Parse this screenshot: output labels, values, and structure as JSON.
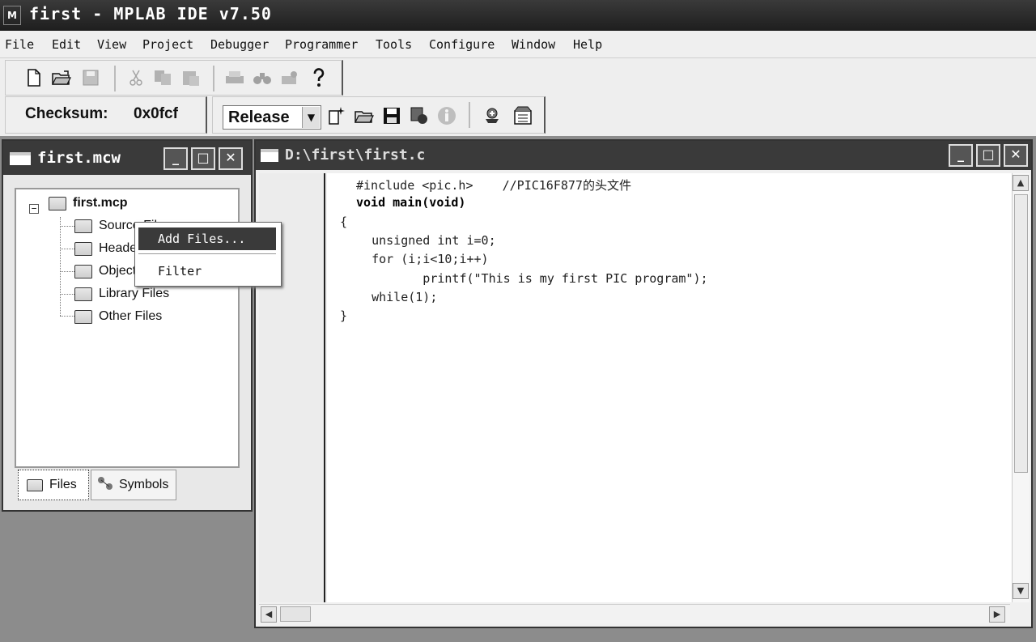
{
  "window": {
    "app_title": "first - MPLAB IDE v7.50",
    "logo_icon": "mplab-logo-icon"
  },
  "menu": [
    "File",
    "Edit",
    "View",
    "Project",
    "Debugger",
    "Programmer",
    "Tools",
    "Configure",
    "Window",
    "Help"
  ],
  "toolbar": {
    "checksum_label": "Checksum:",
    "checksum_value": "0x0fcf",
    "build_config": "Release"
  },
  "project_window": {
    "title": "first.mcw",
    "root": "first.mcp",
    "folders": [
      "Source Files",
      "Header Files",
      "Object Files",
      "Library Files",
      "Other Files"
    ],
    "tabs": [
      "Files",
      "Symbols"
    ]
  },
  "context_menu": {
    "items": [
      "Add Files...",
      "Filter"
    ]
  },
  "editor": {
    "title": "D:\\first\\first.c",
    "lines": [
      "#include <pic.h>    //PIC16F877的头文件",
      "void main(void)",
      "{",
      "   unsigned int i=0;",
      "   for (i;i<10;i++)",
      "          printf(\"This is my first PIC program\");",
      "   while(1);",
      "}"
    ]
  }
}
